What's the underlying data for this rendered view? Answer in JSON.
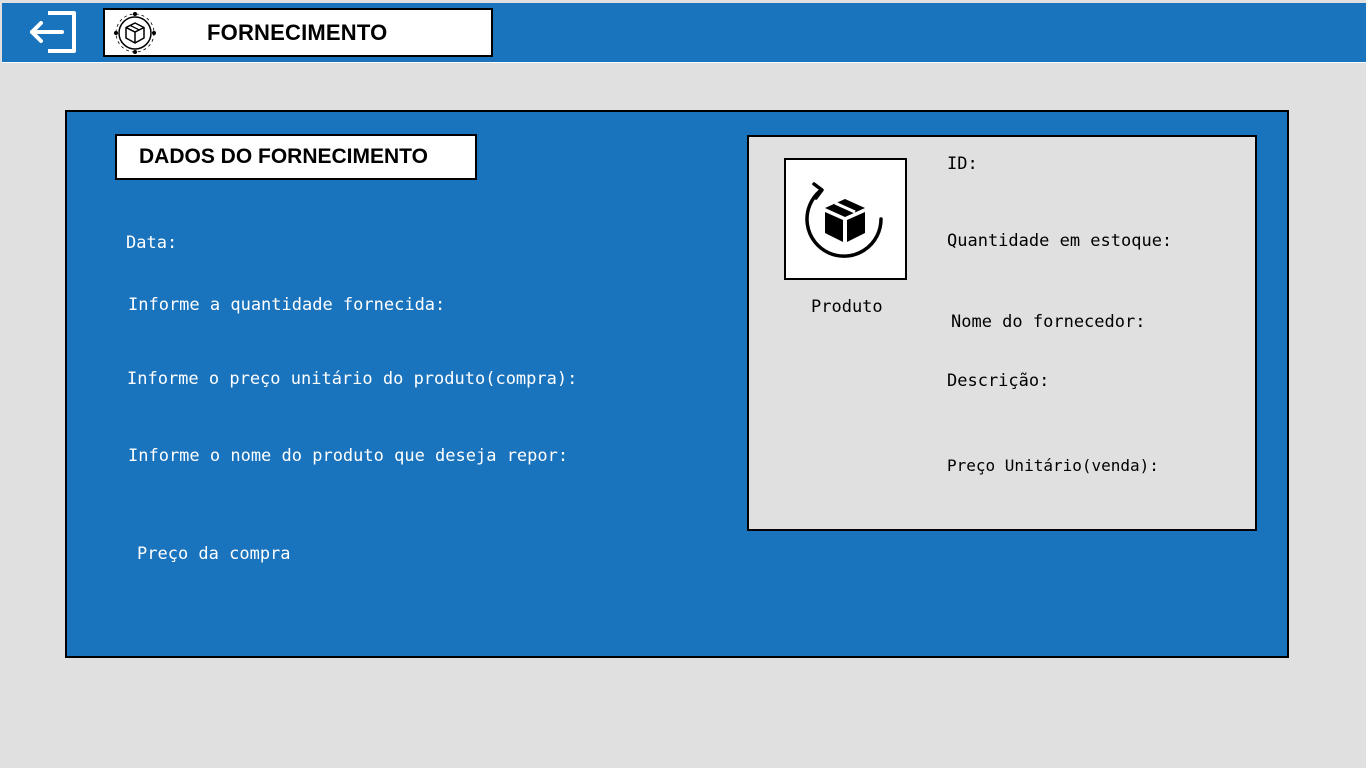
{
  "header": {
    "title": "FORNECIMENTO",
    "exit_icon": "exit-icon",
    "logo_icon": "package-logo-icon",
    "background_color": "#1a73bd"
  },
  "form": {
    "section_title": "DADOS DO FORNECIMENTO",
    "fields": [
      {
        "label": "Data:"
      },
      {
        "label": "Informe a quantidade fornecida:"
      },
      {
        "label": "Informe o preço unitário do produto(compra):"
      },
      {
        "label": "Informe o nome do produto que deseja repor:"
      }
    ],
    "price_button_label": "Preço da compra"
  },
  "product_card": {
    "image_icon": "product-box-icon",
    "caption": "Produto",
    "fields": [
      {
        "label": "ID:"
      },
      {
        "label": "Quantidade em estoque:"
      },
      {
        "label": "Nome do fornecedor:"
      },
      {
        "label": "Descrição:"
      },
      {
        "label": "Preço Unitário(venda):"
      }
    ]
  }
}
